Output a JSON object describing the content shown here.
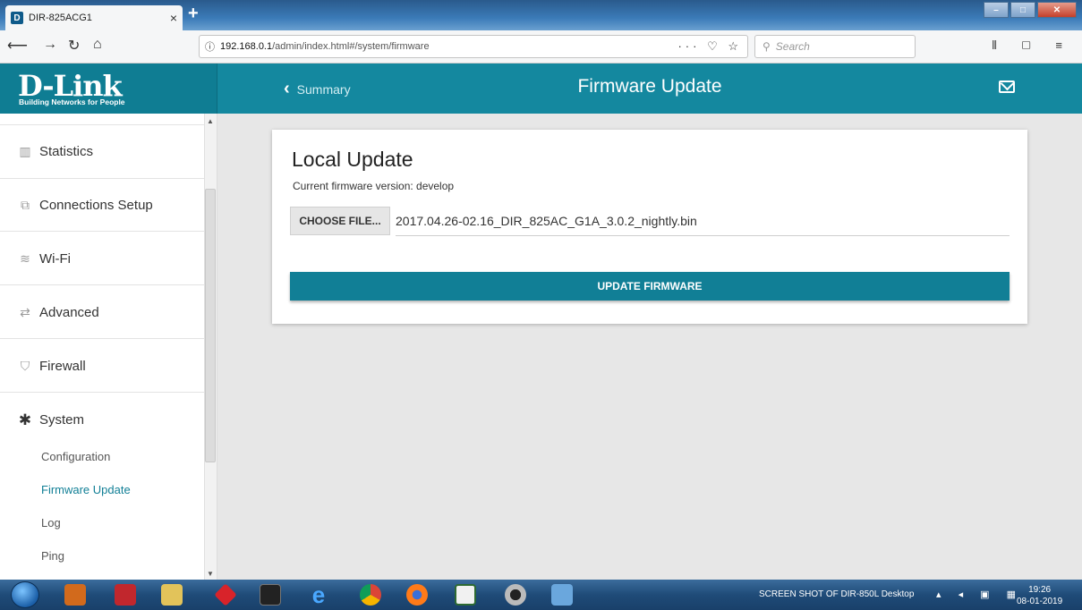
{
  "browser": {
    "tab_title": "DIR-825ACG1",
    "tab_favicon": "D",
    "tab_close": "×",
    "new_tab": "+",
    "url_host": "192.168.0.1",
    "url_path": "/admin/index.html#/system/firmware",
    "search_placeholder": "Search"
  },
  "header": {
    "brand": "D-Link",
    "tagline": "Building Networks for People",
    "back_label": "Summary",
    "page_title": "Firmware Update",
    "accent_color": "#14889f"
  },
  "sidebar": {
    "items": [
      {
        "label": "Statistics",
        "icon": "bar-chart-icon"
      },
      {
        "label": "Connections Setup",
        "icon": "connections-icon"
      },
      {
        "label": "Wi-Fi",
        "icon": "wifi-icon"
      },
      {
        "label": "Advanced",
        "icon": "arrows-icon"
      },
      {
        "label": "Firewall",
        "icon": "shield-icon"
      },
      {
        "label": "System",
        "icon": "gear-icon"
      }
    ],
    "subitems": [
      {
        "label": "Configuration",
        "active": false
      },
      {
        "label": "Firmware Update",
        "active": true
      },
      {
        "label": "Log",
        "active": false
      },
      {
        "label": "Ping",
        "active": false
      }
    ]
  },
  "card": {
    "title": "Local Update",
    "version_text": "Current firmware version: develop",
    "choose_label": "CHOOSE FILE...",
    "filename": "2017.04.26-02.16_DIR_825AC_G1A_3.0.2_nightly.bin",
    "update_label": "UPDATE FIRMWARE"
  },
  "taskbar": {
    "label": "SCREEN SHOT OF DIR-850L  Desktop",
    "time": "19:26",
    "date": "08-01-2019"
  }
}
